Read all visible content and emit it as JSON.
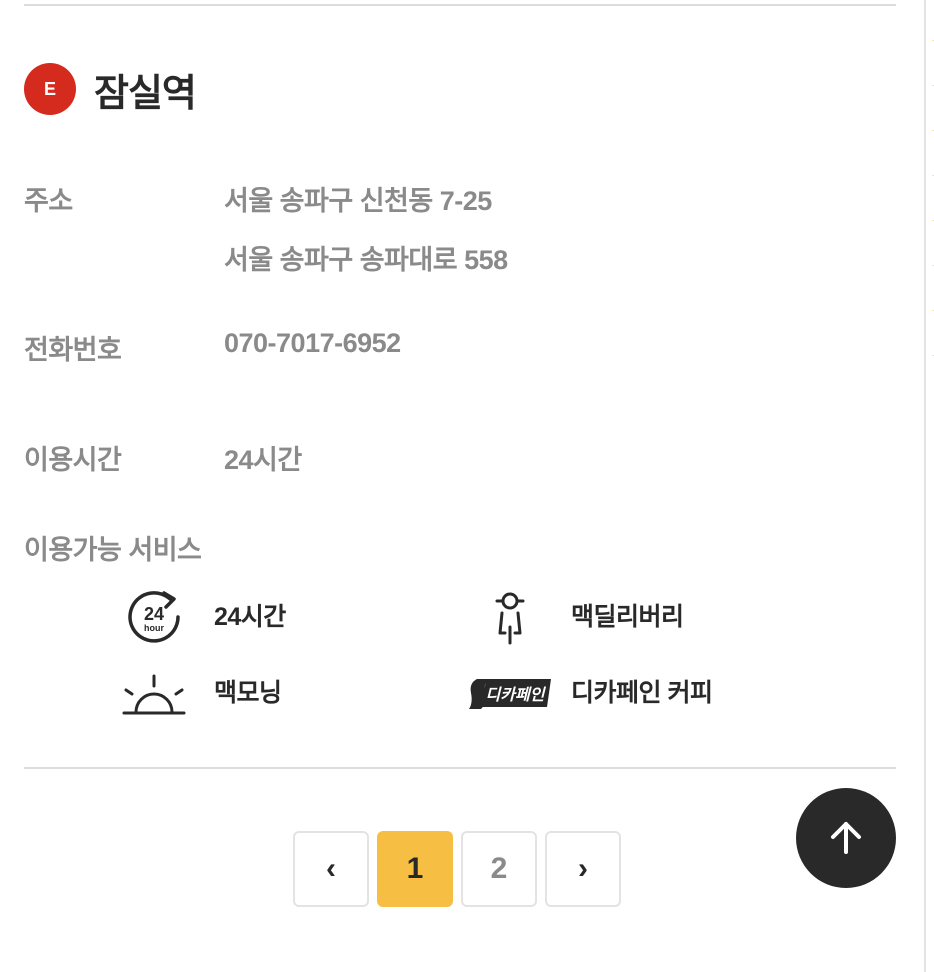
{
  "store": {
    "badge": "E",
    "name": "잠실역"
  },
  "info": {
    "address_label": "주소",
    "address_lot": "서울 송파구 신천동 7-25",
    "address_road": "서울 송파구 송파대로 558",
    "phone_label": "전화번호",
    "phone": "070-7017-6952",
    "hours_label": "이용시간",
    "hours": "24시간"
  },
  "services": {
    "title": "이용가능 서비스",
    "items": [
      {
        "label": "24시간",
        "icon": "24-hour-icon"
      },
      {
        "label": "맥딜리버리",
        "icon": "delivery-scooter-icon"
      },
      {
        "label": "맥모닝",
        "icon": "sunrise-icon"
      },
      {
        "label": "디카페인 커피",
        "icon": "decaf-logo-icon"
      }
    ],
    "icon_text_24": "24",
    "icon_text_hour": "hour",
    "icon_text_decaf": "디카페인"
  },
  "pagination": {
    "prev": "‹",
    "pages": [
      "1",
      "2"
    ],
    "current": "1",
    "next": "›"
  },
  "colors": {
    "badge": "#d42b1e",
    "active_page": "#f6be42",
    "text_dark": "#292929",
    "text_muted": "#8a8a8a"
  }
}
